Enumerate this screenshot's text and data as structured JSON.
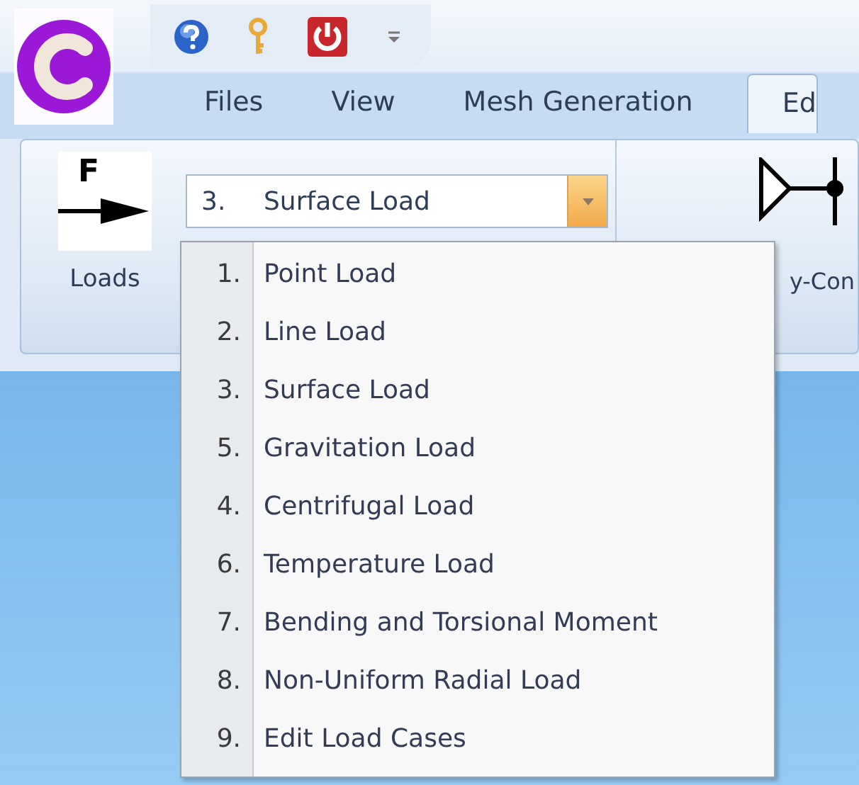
{
  "tabs": [
    {
      "label": "Files",
      "selected": false
    },
    {
      "label": "View",
      "selected": false
    },
    {
      "label": "Mesh Generation",
      "selected": false
    },
    {
      "label": "Ed",
      "selected": true
    }
  ],
  "ribbon": {
    "loads_button": {
      "icon_letter": "F",
      "label": "Loads"
    },
    "combo": {
      "number": "3.",
      "value": "Surface Load"
    },
    "cut_button": {
      "label": "y-Con"
    }
  },
  "menu": [
    {
      "number": "1.",
      "label": "Point Load"
    },
    {
      "number": "2.",
      "label": "Line Load"
    },
    {
      "number": "3.",
      "label": "Surface Load"
    },
    {
      "number": "5.",
      "label": "Gravitation Load"
    },
    {
      "number": "4.",
      "label": "Centrifugal Load"
    },
    {
      "number": "6.",
      "label": "Temperature Load"
    },
    {
      "number": "7.",
      "label": "Bending and Torsional Moment"
    },
    {
      "number": "8.",
      "label": "Non-Uniform Radial Load"
    },
    {
      "number": "9.",
      "label": "Edit Load Cases"
    }
  ]
}
